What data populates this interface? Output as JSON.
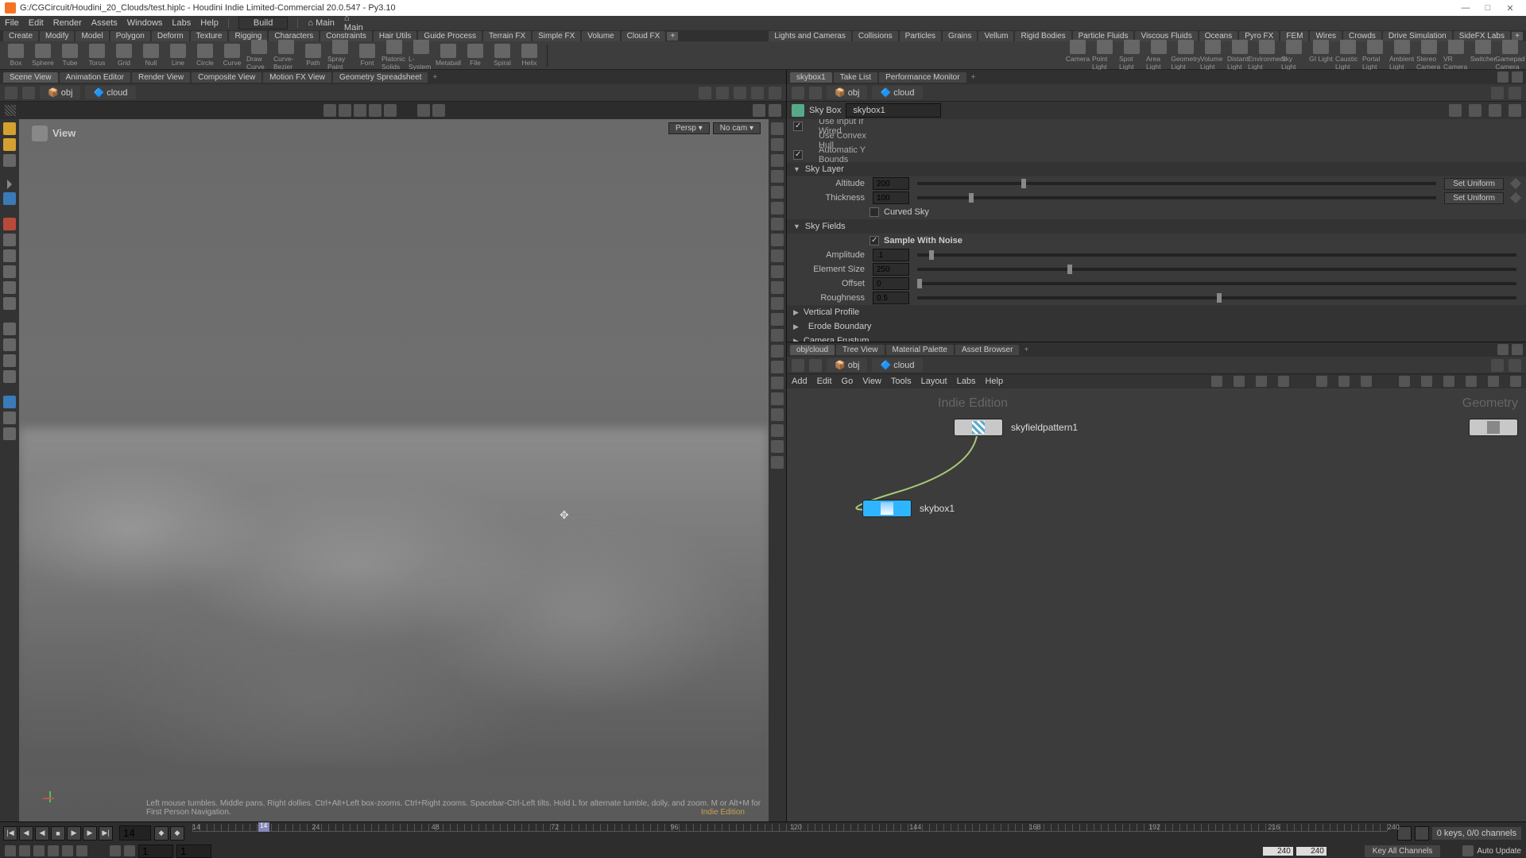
{
  "title": "G:/CGCircuit/Houdini_20_Clouds/test.hiplc - Houdini Indie Limited-Commercial 20.0.547 - Py3.10",
  "menu": [
    "File",
    "Edit",
    "Render",
    "Assets",
    "Windows",
    "Labs",
    "Help"
  ],
  "build_label": "Build",
  "main_label": "Main",
  "shelf_tabs_left": [
    "Create",
    "Modify",
    "Model",
    "Polygon",
    "Deform",
    "Texture",
    "Rigging",
    "Characters",
    "Constraints",
    "Hair Utils",
    "Guide Process",
    "Terrain FX",
    "Simple FX",
    "Volume",
    "Cloud FX"
  ],
  "shelf_tabs_right": [
    "Lights and Cameras",
    "Collisions",
    "Particles",
    "Grains",
    "Vellum",
    "Rigid Bodies",
    "Particle Fluids",
    "Viscous Fluids",
    "Oceans",
    "Pyro FX",
    "FEM",
    "Wires",
    "Crowds",
    "Drive Simulation",
    "SideFX Labs"
  ],
  "shelf_tools_left": [
    "Box",
    "Sphere",
    "Tube",
    "Torus",
    "Grid",
    "Null",
    "Line",
    "Circle",
    "Curve",
    "Draw Curve",
    "Curve-Bezier",
    "Path",
    "Spray Paint",
    "Font",
    "Platonic Solids",
    "L-System",
    "Metaball",
    "File",
    "Spiral",
    "Helix"
  ],
  "shelf_tools_right": [
    "Camera",
    "Point Light",
    "Spot Light",
    "Area Light",
    "Geometry Light",
    "Volume Light",
    "Distant Light",
    "Environment Light",
    "Sky Light",
    "GI Light",
    "Caustic Light",
    "Portal Light",
    "Ambient Light",
    "Stereo Camera",
    "VR Camera",
    "Switcher",
    "Gamepad Camera"
  ],
  "left_pane_tabs": [
    "Scene View",
    "Animation Editor",
    "Render View",
    "Composite View",
    "Motion FX View",
    "Geometry Spreadsheet"
  ],
  "right_pane_tabs_top": [
    "skybox1",
    "Take List",
    "Performance Monitor"
  ],
  "right_pane_tabs_bottom": [
    "obj/cloud",
    "Tree View",
    "Material Palette",
    "Asset Browser"
  ],
  "path": {
    "obj": "obj",
    "cloud": "cloud"
  },
  "view_label": "View",
  "cam": {
    "persp": "Persp ▾",
    "nocam": "No cam ▾"
  },
  "hint": "Left mouse tumbles. Middle pans. Right dollies. Ctrl+Alt+Left box-zooms. Ctrl+Right zooms. Spacebar-Ctrl-Left tilts. Hold L for alternate tumble, dolly, and zoom. M or Alt+M for First Person Navigation.",
  "edition": "Indie Edition",
  "parm": {
    "node_type": "Sky Box",
    "node_name": "skybox1",
    "use_input": "Use Input If Wired",
    "use_convex": "Use Convex Hull",
    "auto_y": "Automatic Y Bounds",
    "skylayer": "Sky Layer",
    "altitude_label": "Altitude",
    "altitude_value": "200",
    "thickness_label": "Thickness",
    "thickness_value": "100",
    "curved": "Curved Sky",
    "setuniform": "Set Uniform",
    "skyfields": "Sky Fields",
    "sample_noise": "Sample With Noise",
    "amp_label": "Amplitude",
    "amp_value": ".1",
    "elem_label": "Element Size",
    "elem_value": "250",
    "offset_label": "Offset",
    "offset_value": "0",
    "rough_label": "Roughness",
    "rough_value": "0.5",
    "vert_profile": "Vertical Profile",
    "erode": "Erode Boundary",
    "frustum": "Camera Frustum"
  },
  "netmenu": [
    "Add",
    "Edit",
    "Go",
    "View",
    "Tools",
    "Layout",
    "Labs",
    "Help"
  ],
  "nodes": {
    "n1": "skyfieldpattern1",
    "n2": "skybox1",
    "watermark1": "Indie Edition",
    "watermark2": "Geometry"
  },
  "timeline": {
    "frame": "14",
    "marks": [
      "14",
      "24",
      "48",
      "72",
      "96",
      "120",
      "144",
      "168",
      "192",
      "216",
      "240"
    ],
    "range_start": "240",
    "range_end": "240",
    "frame1": "1",
    "frame2": "1",
    "keys": "0 keys, 0/0 channels",
    "keyall": "Key All Channels",
    "auto": "Auto Update"
  }
}
